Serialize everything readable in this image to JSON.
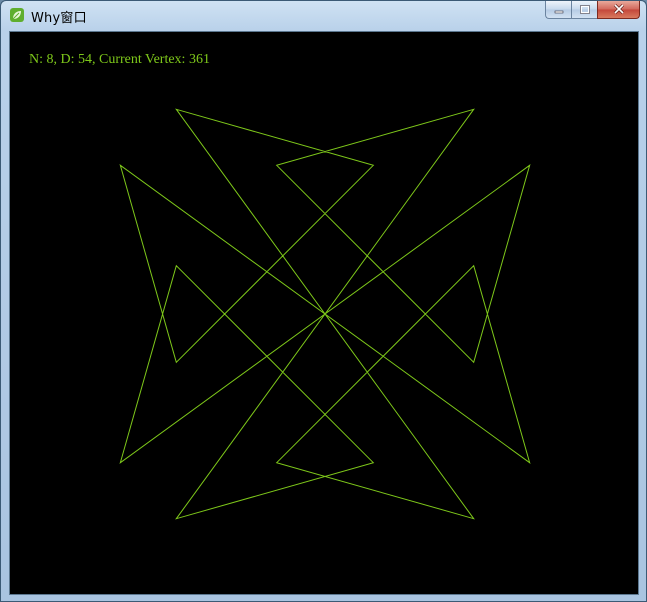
{
  "window": {
    "title": "Why窗口",
    "app_icon": "leaf-icon"
  },
  "caption_buttons": {
    "minimize": "minimize-icon",
    "maximize": "maximize-icon",
    "close": "close-icon"
  },
  "canvas": {
    "background": "#000000",
    "line_color": "#7ec81a",
    "status": "N: 8, D: 54, Current Vertex: 361",
    "rose": {
      "n": 8,
      "d": 54,
      "vertex": 361
    }
  }
}
